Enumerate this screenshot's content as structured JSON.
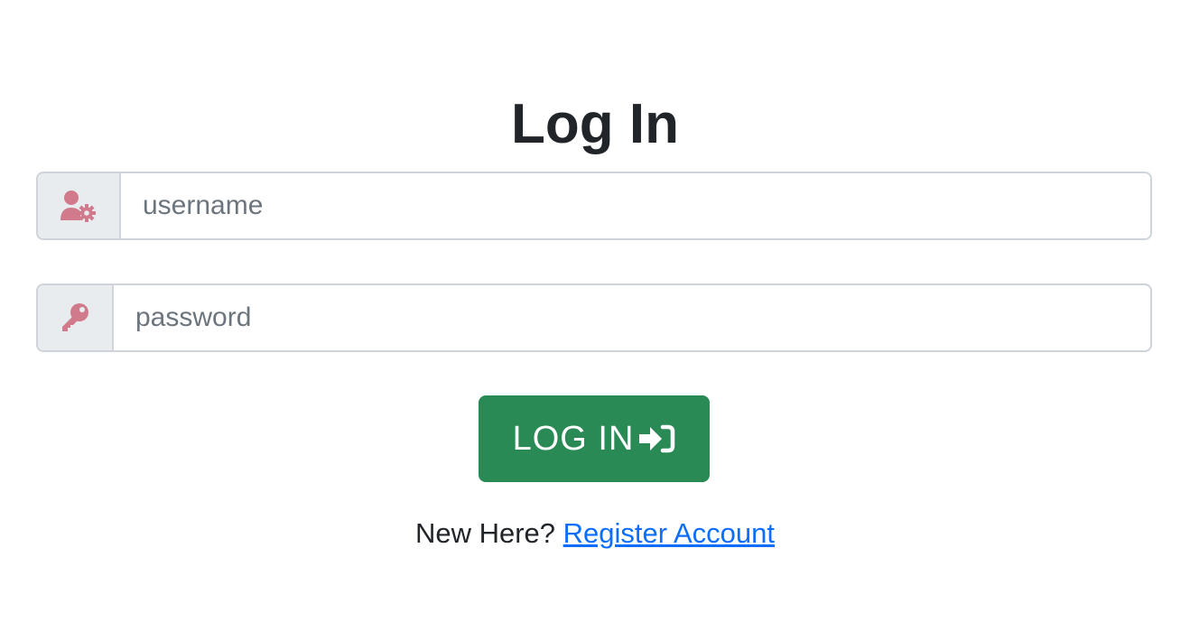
{
  "page": {
    "title": "Log In"
  },
  "form": {
    "username": {
      "placeholder": "username",
      "value": "",
      "icon": "user-gear-icon"
    },
    "password": {
      "placeholder": "password",
      "value": "",
      "icon": "key-icon"
    },
    "submit": {
      "label": "LOG IN",
      "icon": "sign-in-icon"
    }
  },
  "register": {
    "prompt": "New Here?",
    "link_label": "Register Account"
  },
  "colors": {
    "icon": "#d07a8c",
    "button": "#2a8a55",
    "link": "#0d6efd",
    "addon_bg": "#e9ecef"
  }
}
